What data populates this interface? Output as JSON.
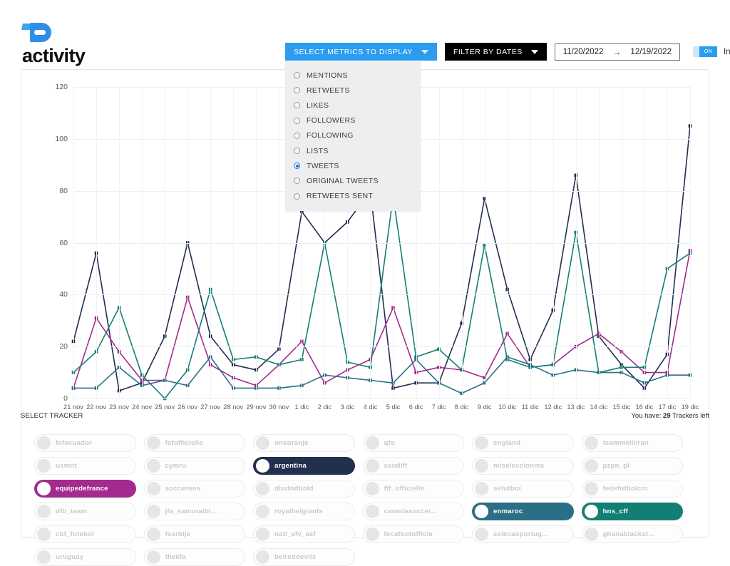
{
  "brand": {
    "name": "activity"
  },
  "toolbar": {
    "metrics_button": "SELECT METRICS TO DISPLAY",
    "dates_button": "FILTER BY DATES",
    "date_from": "11/20/2022",
    "date_to": "12/19/2022",
    "date_arrow": "→",
    "toggle_state": "ON",
    "increment_label": "Increment"
  },
  "metrics_dropdown": {
    "options": [
      {
        "label": "MENTIONS",
        "selected": false
      },
      {
        "label": "RETWEETS",
        "selected": false
      },
      {
        "label": "LIKES",
        "selected": false
      },
      {
        "label": "FOLLOWERS",
        "selected": false
      },
      {
        "label": "FOLLOWING",
        "selected": false
      },
      {
        "label": "LISTS",
        "selected": false
      },
      {
        "label": "TWEETS",
        "selected": true
      },
      {
        "label": "ORIGINAL TWEETS",
        "selected": false
      },
      {
        "label": "RETWEETS SENT",
        "selected": false
      }
    ]
  },
  "tracker_section": {
    "title": "SELECT TRACKER",
    "quota_prefix": "You have:",
    "quota_count": "29",
    "quota_suffix": "Trackers left",
    "chips": [
      {
        "name": "fefecuador",
        "active": false,
        "color": "#c9c9c9"
      },
      {
        "name": "fsfofficielle",
        "active": false,
        "color": "#c9c9c9"
      },
      {
        "name": "onsoranje",
        "active": false,
        "color": "#c9c9c9"
      },
      {
        "name": "qfa",
        "active": false,
        "color": "#c9c9c9"
      },
      {
        "name": "england",
        "active": false,
        "color": "#c9c9c9"
      },
      {
        "name": "teammelliiran",
        "active": false,
        "color": "#c9c9c9"
      },
      {
        "name": "usmnt",
        "active": false,
        "color": "#c9c9c9"
      },
      {
        "name": "cymru",
        "active": false,
        "color": "#c9c9c9"
      },
      {
        "name": "argentina",
        "active": true,
        "color": "#23304d"
      },
      {
        "name": "saudiff",
        "active": false,
        "color": "#c9c9c9"
      },
      {
        "name": "miseleccionmx",
        "active": false,
        "color": "#c9c9c9"
      },
      {
        "name": "pzpn_pl",
        "active": false,
        "color": "#c9c9c9"
      },
      {
        "name": "equipedefrance",
        "active": true,
        "color": "#a32a8e"
      },
      {
        "name": "socceroos",
        "active": false,
        "color": "#c9c9c9"
      },
      {
        "name": "dbufodbold",
        "active": false,
        "color": "#c9c9c9"
      },
      {
        "name": "ftf_officielle",
        "active": false,
        "color": "#c9c9c9"
      },
      {
        "name": "sefutbol",
        "active": false,
        "color": "#c9c9c9"
      },
      {
        "name": "fedefutbolcrc",
        "active": false,
        "color": "#c9c9c9"
      },
      {
        "name": "dfb_team",
        "active": false,
        "color": "#c9c9c9"
      },
      {
        "name": "jfa_samuraibl...",
        "active": false,
        "color": "#c9c9c9"
      },
      {
        "name": "royalbelgianfa",
        "active": false,
        "color": "#c9c9c9"
      },
      {
        "name": "canadasoccer...",
        "active": false,
        "color": "#c9c9c9"
      },
      {
        "name": "enmaroc",
        "active": true,
        "color": "#2b6f86"
      },
      {
        "name": "hns_cff",
        "active": true,
        "color": "#137f74"
      },
      {
        "name": "cbf_futebol",
        "active": false,
        "color": "#c9c9c9"
      },
      {
        "name": "fssrbije",
        "active": false,
        "color": "#c9c9c9"
      },
      {
        "name": "nati_sfv_asf",
        "active": false,
        "color": "#c9c9c9"
      },
      {
        "name": "fecafootofficie",
        "active": false,
        "color": "#c9c9c9"
      },
      {
        "name": "selecaoportug...",
        "active": false,
        "color": "#c9c9c9"
      },
      {
        "name": "ghanablackst...",
        "active": false,
        "color": "#c9c9c9"
      },
      {
        "name": "uruguay",
        "active": false,
        "color": "#c9c9c9"
      },
      {
        "name": "thekfa",
        "active": false,
        "color": "#c9c9c9"
      },
      {
        "name": "belreddevils",
        "active": false,
        "color": "#c9c9c9"
      }
    ]
  },
  "chart_data": {
    "type": "line",
    "title": "",
    "xlabel": "",
    "ylabel": "",
    "ylim": [
      0,
      120
    ],
    "yticks": [
      0,
      20,
      40,
      60,
      80,
      100,
      120
    ],
    "grid": true,
    "legend_position": "below-as-chips",
    "categories": [
      "21 nov",
      "22 nov",
      "23 nov",
      "24 nov",
      "25 nov",
      "26 nov",
      "27 nov",
      "28 nov",
      "29 nov",
      "30 nov",
      "1 dic",
      "2 dic",
      "3 dic",
      "4 dic",
      "5 dic",
      "6 dic",
      "7 dic",
      "8 dic",
      "9 dic",
      "10 dic",
      "11 dic",
      "12 dic",
      "13 dic",
      "14 dic",
      "15 dic",
      "16 dic",
      "17 dic",
      "19 dic"
    ],
    "series": [
      {
        "name": "argentina",
        "color": "#23304d",
        "values": [
          22,
          56,
          3,
          6,
          24,
          60,
          24,
          13,
          11,
          19,
          72,
          60,
          68,
          80,
          4,
          6,
          6,
          29,
          77,
          42,
          15,
          34,
          86,
          24,
          13,
          4,
          17,
          105
        ]
      },
      {
        "name": "equipedefrance",
        "color": "#a32a8e",
        "values": [
          4,
          31,
          18,
          7,
          7,
          39,
          13,
          8,
          5,
          13,
          22,
          6,
          11,
          15,
          35,
          10,
          12,
          11,
          8,
          25,
          12,
          13,
          20,
          25,
          18,
          10,
          10,
          57
        ]
      },
      {
        "name": "hns_cff",
        "color": "#137f74",
        "values": [
          10,
          18,
          35,
          9,
          0,
          11,
          42,
          15,
          16,
          13,
          15,
          60,
          14,
          12,
          78,
          16,
          19,
          11,
          59,
          15,
          12,
          13,
          64,
          10,
          12,
          12,
          50,
          56
        ]
      },
      {
        "name": "enmaroc",
        "color": "#2b6f86",
        "values": [
          4,
          4,
          12,
          5,
          7,
          5,
          16,
          4,
          4,
          4,
          5,
          9,
          8,
          7,
          6,
          15,
          6,
          2,
          6,
          16,
          13,
          9,
          11,
          10,
          10,
          6,
          9,
          9
        ]
      }
    ]
  }
}
